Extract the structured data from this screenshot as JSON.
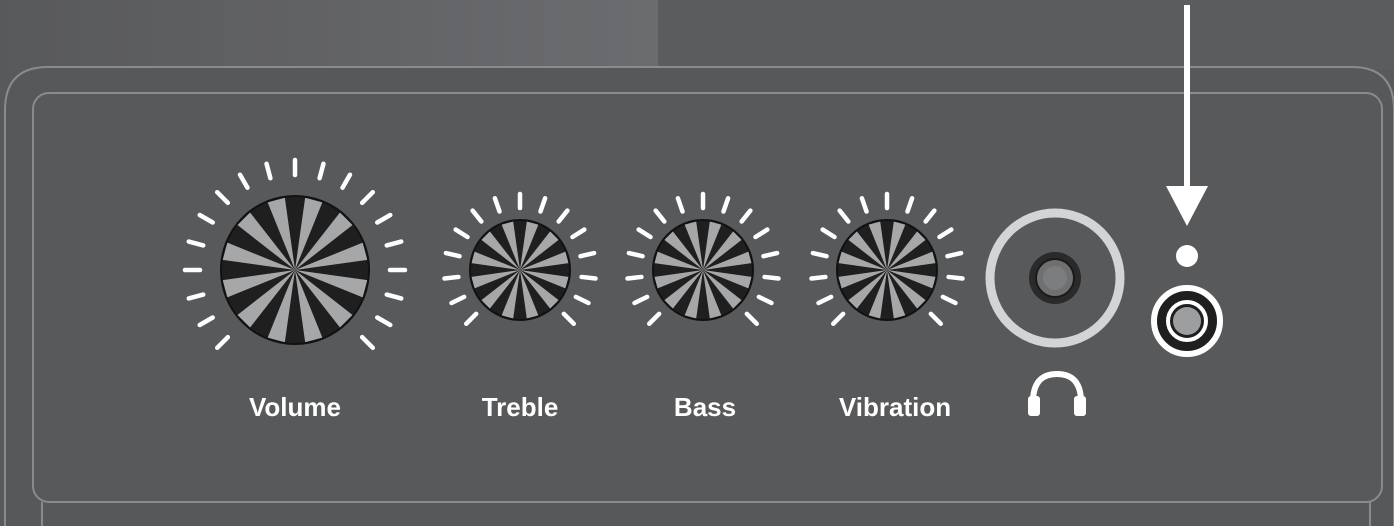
{
  "panel": {
    "knobs": [
      {
        "id": "volume",
        "label": "Volume"
      },
      {
        "id": "treble",
        "label": "Treble"
      },
      {
        "id": "bass",
        "label": "Bass"
      },
      {
        "id": "vibration",
        "label": "Vibration"
      }
    ],
    "headphone_jack": {
      "icon": "headphones-icon"
    },
    "indicator": {
      "icon": "down-arrow-icon",
      "led_color": "#ffffff"
    }
  },
  "colors": {
    "panel": "#58595b",
    "knob_dark": "#1f1f20",
    "knob_light": "#a6a7a9",
    "tick": "#ffffff"
  }
}
